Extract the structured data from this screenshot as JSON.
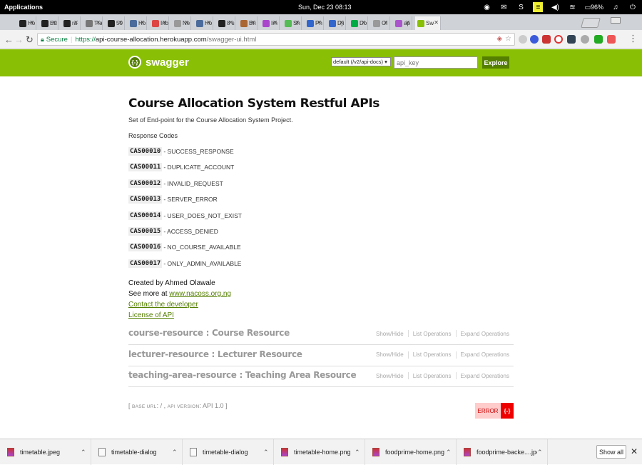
{
  "os": {
    "apps_label": "Applications",
    "clock": "Sun, Dec 23   08:13",
    "battery": "96%"
  },
  "tabs": [
    {
      "label": "Ho",
      "icon": "medium-icon",
      "color": "#222"
    },
    {
      "label": "Ed",
      "icon": "github-icon",
      "color": "#222"
    },
    {
      "label": "ra",
      "icon": "github-icon",
      "color": "#222"
    },
    {
      "label": "Tra",
      "icon": "doc-icon",
      "color": "#777"
    },
    {
      "label": "50",
      "icon": "briefcase-icon",
      "color": "#222"
    },
    {
      "label": "Ho",
      "icon": "doc-icon",
      "color": "#4a6b9b"
    },
    {
      "label": "Inb",
      "icon": "gmail-icon",
      "color": "#d44"
    },
    {
      "label": "Ne",
      "icon": "page-icon",
      "color": "#999"
    },
    {
      "label": "Ho",
      "icon": "doc-icon",
      "color": "#4a6b9b"
    },
    {
      "label": "8 s",
      "icon": "medium-icon",
      "color": "#222"
    },
    {
      "label": "Bri",
      "icon": "chart-icon",
      "color": "#a63"
    },
    {
      "label": "Im",
      "icon": "jpg-icon",
      "color": "#a4c"
    },
    {
      "label": "Sh",
      "icon": "s-icon",
      "color": "#5b5"
    },
    {
      "label": "Ph",
      "icon": "pj-icon",
      "color": "#36c"
    },
    {
      "label": "Dji",
      "icon": "dj-icon",
      "color": "#36c"
    },
    {
      "label": "Do",
      "icon": "n-icon",
      "color": "#0a4"
    },
    {
      "label": "Ol",
      "icon": "page-icon",
      "color": "#999"
    },
    {
      "label": "ap",
      "icon": "s-icon",
      "color": "#a5c"
    },
    {
      "label": "Sw",
      "icon": "swagger-icon",
      "color": "#89bf04",
      "active": true
    }
  ],
  "address": {
    "secure_label": "Secure",
    "protocol": "https://",
    "host": "api-course-allocation.herokuapp.com",
    "path": "/swagger-ui.html"
  },
  "swagger": {
    "brand": "swagger",
    "spec_select": "default (/v2/api-docs)",
    "api_key_placeholder": "api_key",
    "explore_label": "Explore"
  },
  "info": {
    "title": "Course Allocation System Restful APIs",
    "description": "Set of End-point for the Course Allocation System Project.",
    "response_codes_heading": "Response Codes",
    "codes": [
      {
        "code": "CAS00010",
        "desc": "- SUCCESS_RESPONSE"
      },
      {
        "code": "CAS00011",
        "desc": "- DUPLICATE_ACCOUNT"
      },
      {
        "code": "CAS00012",
        "desc": "- INVALID_REQUEST"
      },
      {
        "code": "CAS00013",
        "desc": "- SERVER_ERROR"
      },
      {
        "code": "CAS00014",
        "desc": "- USER_DOES_NOT_EXIST"
      },
      {
        "code": "CAS00015",
        "desc": "- ACCESS_DENIED"
      },
      {
        "code": "CAS00016",
        "desc": "- NO_COURSE_AVAILABLE"
      },
      {
        "code": "CAS00017",
        "desc": "- ONLY_ADMIN_AVAILABLE"
      }
    ],
    "created_by": "Created by Ahmed Olawale",
    "see_more_prefix": "See more at ",
    "see_more_link": "www.nacoss.org.ng",
    "contact_link": "Contact the developer",
    "license_link": "License of API"
  },
  "resources": [
    {
      "name": "course-resource : Course Resource"
    },
    {
      "name": "lecturer-resource : Lecturer Resource"
    },
    {
      "name": "teaching-area-resource : Teaching Area Resource"
    }
  ],
  "resource_ops": {
    "show_hide": "Show/Hide",
    "list_ops": "List Operations",
    "expand_ops": "Expand Operations"
  },
  "footer": {
    "open_bracket": "[ ",
    "base_url_label": "BASE URL",
    "base_url_value": ": / , ",
    "api_version_label": "API VERSION",
    "api_version_value": ": API 1.0 ]",
    "error_label": "ERROR",
    "error_icon": "{-}"
  },
  "downloads": [
    {
      "name": "timetable.jpeg",
      "type": "img"
    },
    {
      "name": "timetable-dialog",
      "type": "file"
    },
    {
      "name": "timetable-dialog",
      "type": "file"
    },
    {
      "name": "timetable-home.png",
      "type": "img"
    },
    {
      "name": "foodprime-home.png",
      "type": "img"
    },
    {
      "name": "foodprime-backe....jpeg",
      "type": "img"
    }
  ],
  "shelf": {
    "show_all_label": "Show all",
    "close_glyph": "✕"
  }
}
